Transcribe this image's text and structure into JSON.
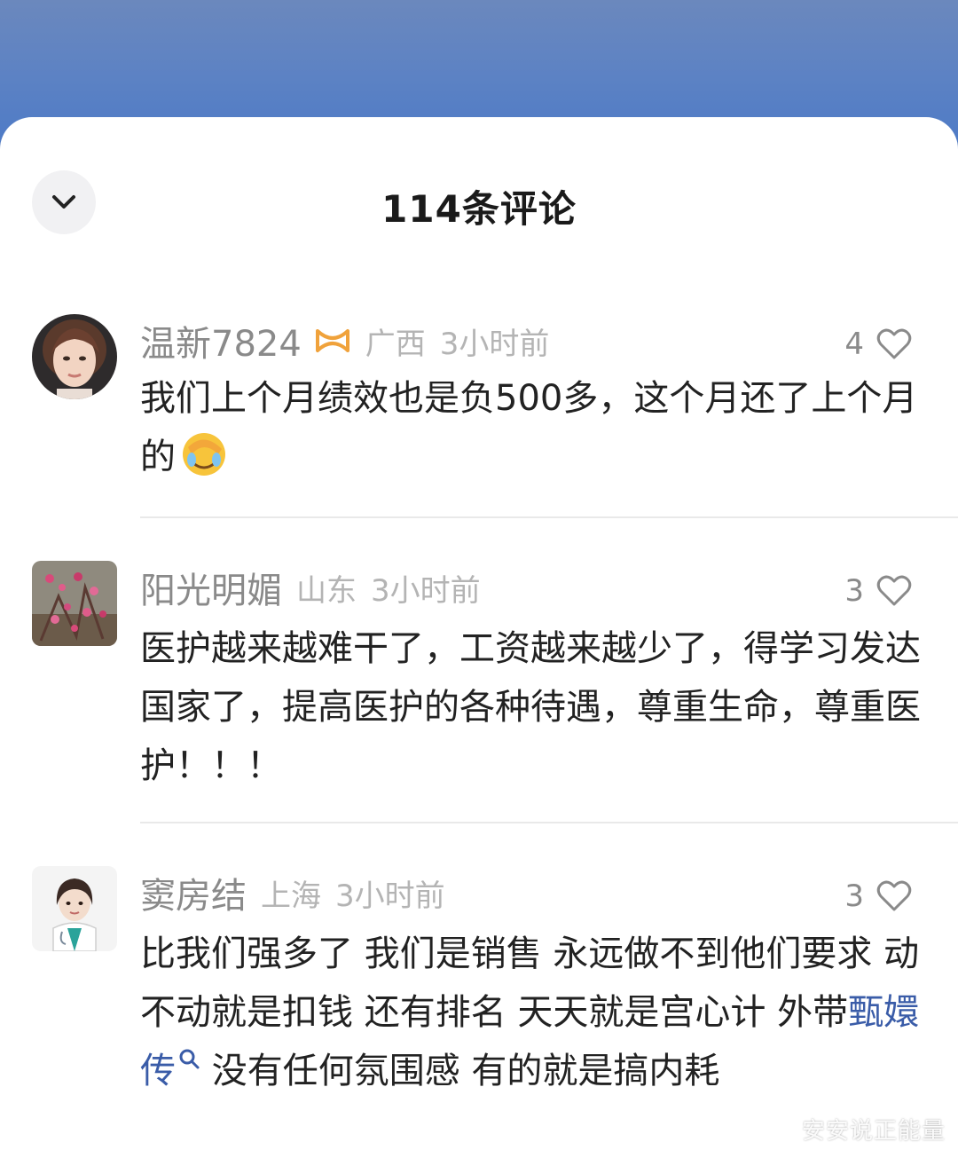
{
  "sheet": {
    "title": "114条评论"
  },
  "comments": [
    {
      "username": "温新7824",
      "location": "广西",
      "time": "3小时前",
      "likes": "4",
      "text_main": "我们上个月绩效也是负500多，这个月还了上个月的",
      "text_link": "",
      "text_after": ""
    },
    {
      "username": "阳光明媚",
      "location": "山东",
      "time": "3小时前",
      "likes": "3",
      "text_main": "医护越来越难干了，工资越来越少了，得学习发达国家了，提高医护的各种待遇，尊重生命，尊重医护！！！",
      "text_link": "",
      "text_after": ""
    },
    {
      "username": "窦房结",
      "location": "上海",
      "time": "3小时前",
      "likes": "3",
      "text_main": "比我们强多了  我们是销售 永远做不到他们要求 动不动就是扣钱 还有排名  天天就是宫心计 外带",
      "text_link": "甄嬛传",
      "text_after": "  没有任何氛围感 有的就是搞内耗"
    }
  ],
  "watermark": "安安说正能量",
  "colors": {
    "header_blue": "#5c82c4",
    "username_gray": "#8a8a8a",
    "meta_gray": "#b4b4b4",
    "link_blue": "#3a5ca8",
    "badge_orange": "#f0a23b"
  },
  "icons": {
    "collapse": "chevron-down-icon",
    "like": "heart-outline-icon",
    "badge": "fan-badge-icon",
    "search": "search-icon",
    "emoji": "facepalm-emoji-icon"
  }
}
